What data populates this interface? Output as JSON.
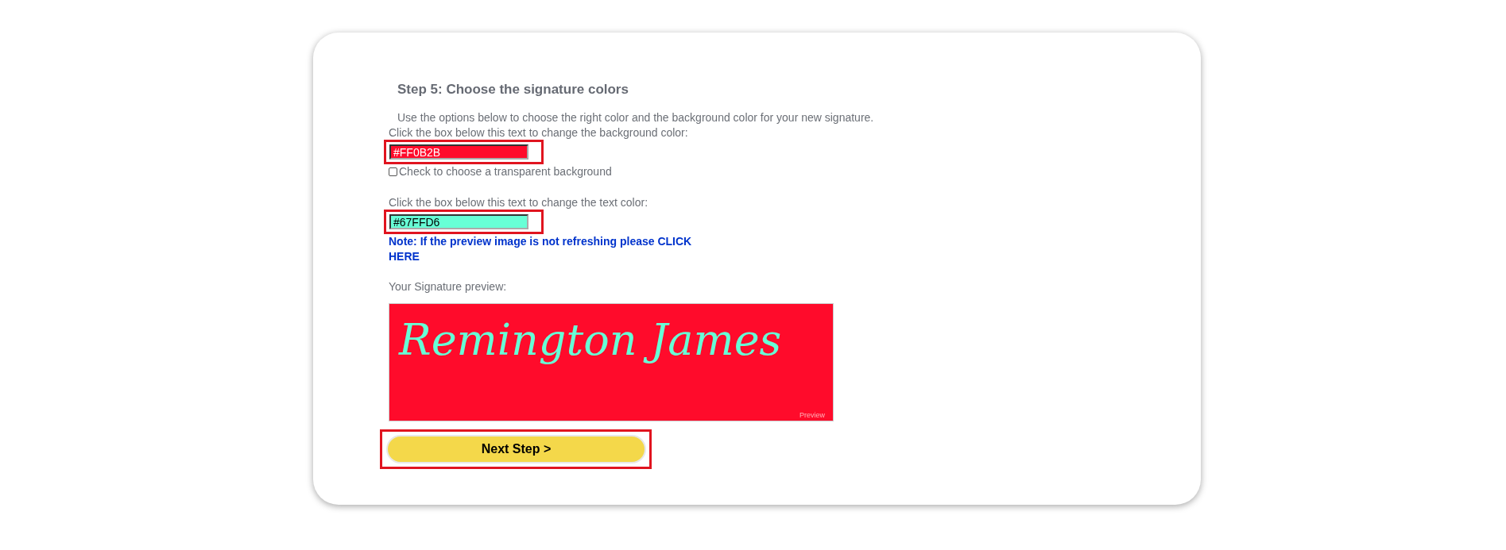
{
  "step": {
    "title": "Step 5: Choose the signature colors",
    "intro": "Use the options below to choose the right color and the background color for your new signature.",
    "background_label": "Click the box below this text to change the background color:",
    "background_field": {
      "value": "#FF0B2B"
    },
    "transparent_option": {
      "label": "Check to choose a transparent background",
      "checked": false
    },
    "text_label": "Click the box below this text to change the text color:",
    "text_field": {
      "value": "#67FFD6"
    },
    "note": "Note: If the preview image is not refreshing please CLICK HERE",
    "preview_label": "Your Signature preview:",
    "preview": {
      "signature": "Remington James",
      "watermark": "Preview"
    },
    "next_button": "Next Step >"
  }
}
